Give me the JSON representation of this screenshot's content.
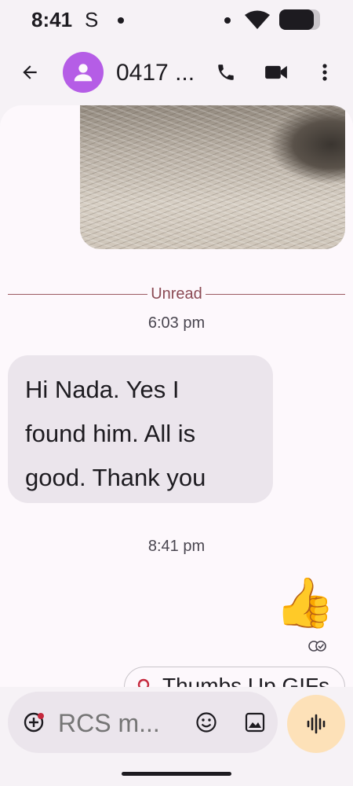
{
  "status_bar": {
    "time": "8:41",
    "carrier_letter": "S",
    "battery_level": 0.85,
    "icons": [
      "notification-dot",
      "signal-dot",
      "wifi-icon",
      "battery-icon"
    ]
  },
  "header": {
    "contact_name": "0417 ...",
    "icons": [
      "back-arrow-icon",
      "person-icon",
      "phone-icon",
      "video-camera-icon",
      "more-vert-icon"
    ]
  },
  "conversation": {
    "unread_label": "Unread",
    "messages": [
      {
        "timestamp": "6:03 pm",
        "direction": "incoming",
        "lines": [
          "Hi Nada. Yes I",
          "found him. All is",
          "good. Thank you"
        ]
      },
      {
        "timestamp": "8:41 pm",
        "direction": "outgoing",
        "content": "👍"
      }
    ],
    "suggestion_chip": "Thumbs Up GIFs"
  },
  "composer": {
    "placeholder": "RCS m...",
    "icons": [
      "add-icon",
      "emoji-icon",
      "gallery-icon",
      "voice-waveform-icon"
    ]
  },
  "colors": {
    "accent_avatar": "#b55de6",
    "unread": "#8b4a54",
    "voice_button": "#fde1b8",
    "bubble": "#ebe5ec"
  }
}
